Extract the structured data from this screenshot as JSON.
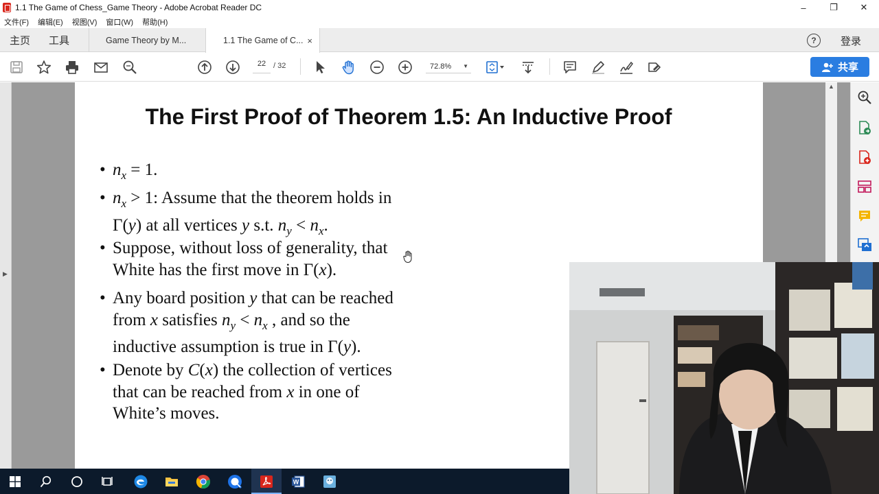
{
  "window": {
    "title": "1.1 The Game of Chess_Game Theory - Adobe Acrobat Reader DC",
    "minimize": "–",
    "restore": "❐",
    "close": "✕"
  },
  "menu": [
    "文件(F)",
    "编辑(E)",
    "视图(V)",
    "窗口(W)",
    "帮助(H)"
  ],
  "nav_tabs": {
    "home": "主页",
    "tools": "工具"
  },
  "doc_tabs": [
    {
      "label": "Game Theory by M..."
    },
    {
      "label": "1.1 The Game of C...",
      "close": "×"
    }
  ],
  "header_right": {
    "help": "?",
    "login": "登录"
  },
  "toolbar": {
    "page_current": "22",
    "page_total": "/ 32",
    "zoom": "72.8%",
    "share_label": "共享"
  },
  "slide": {
    "title": "The First Proof of Theorem 1.5: An Inductive Proof",
    "bullet_symbol": "•"
  },
  "icons": {
    "save": "save-icon",
    "bookmark": "star-icon",
    "print": "printer-icon",
    "email": "mail-icon",
    "search": "search-icon",
    "prev": "arrow-up-circle-icon",
    "next": "arrow-down-circle-icon",
    "select": "cursor-icon",
    "hand": "hand-icon",
    "zoom_out": "zoom-out-icon",
    "zoom_in": "zoom-in-icon"
  },
  "colors": {
    "accent": "#2a7de1",
    "taskbar": "#0c1a2b",
    "acrobat_red": "#d9261c"
  }
}
